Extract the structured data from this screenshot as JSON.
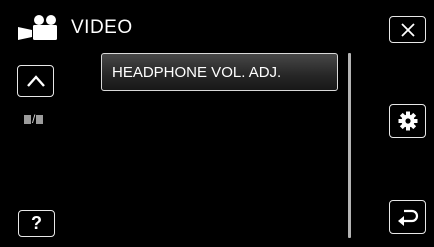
{
  "header": {
    "title": "VIDEO",
    "mode_icon": "video-camera-icon"
  },
  "buttons": {
    "close": {
      "icon": "close-x-icon"
    },
    "up": {
      "icon": "chevron-up-icon"
    },
    "settings": {
      "icon": "gear-icon"
    },
    "back": {
      "icon": "return-arrow-icon"
    },
    "help": {
      "label": "?"
    }
  },
  "page_indicator": {
    "separator": "/"
  },
  "menu": {
    "items": [
      {
        "label": "HEADPHONE VOL. ADJ.",
        "selected": true
      }
    ]
  },
  "colors": {
    "background": "#000000",
    "border": "#e8e8e8",
    "text": "#ffffff"
  }
}
